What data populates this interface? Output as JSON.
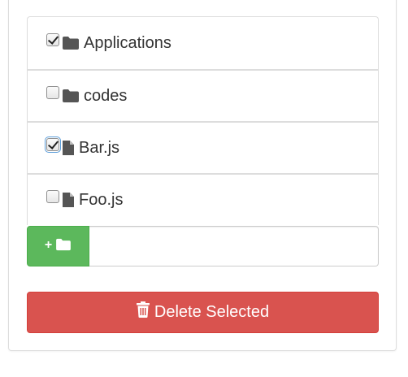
{
  "file_list": {
    "items": [
      {
        "label": "Applications",
        "type": "folder",
        "checked": true
      },
      {
        "label": "codes",
        "type": "folder",
        "checked": false
      },
      {
        "label": "Bar.js",
        "type": "file",
        "checked": true
      },
      {
        "label": "Foo.js",
        "type": "file",
        "checked": false
      }
    ]
  },
  "add_folder": {
    "button_plus": "+",
    "button_icon": "folder-icon",
    "input_value": "",
    "input_placeholder": ""
  },
  "delete": {
    "label": "Delete Selected",
    "icon": "trash-icon"
  },
  "colors": {
    "success": "#5cb85c",
    "danger": "#d9534f",
    "icon": "#555555",
    "border": "#dddddd"
  }
}
